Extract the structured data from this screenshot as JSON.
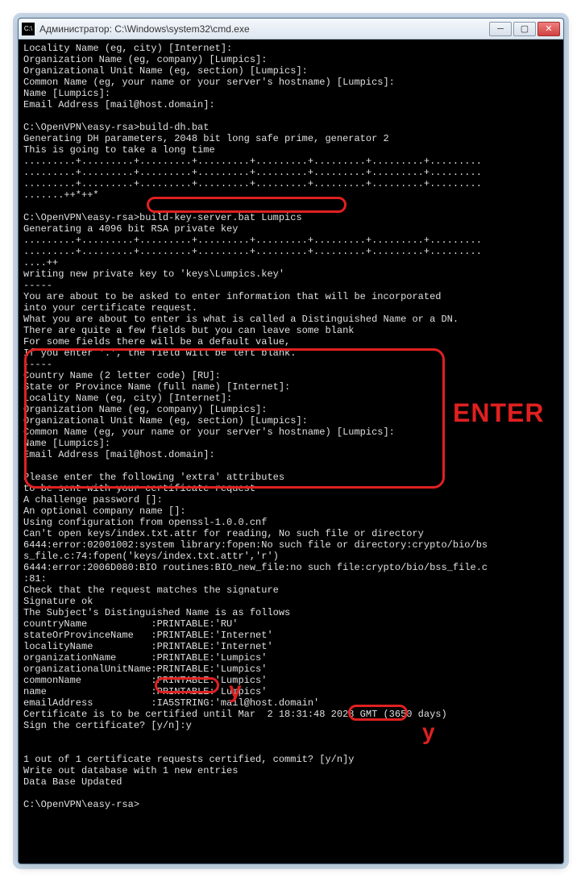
{
  "window": {
    "title": "Администратор: C:\\Windows\\system32\\cmd.exe"
  },
  "terminal": {
    "lines": [
      "Locality Name (eg, city) [Internet]:",
      "Organization Name (eg, company) [Lumpics]:",
      "Organizational Unit Name (eg, section) [Lumpics]:",
      "Common Name (eg, your name or your server's hostname) [Lumpics]:",
      "Name [Lumpics]:",
      "Email Address [mail@host.domain]:",
      "",
      "C:\\OpenVPN\\easy-rsa>build-dh.bat",
      "Generating DH parameters, 2048 bit long safe prime, generator 2",
      "This is going to take a long time",
      ".........+.........+.........+.........+.........+.........+.........+.........",
      ".........+.........+.........+.........+.........+.........+.........+.........",
      ".........+.........+.........+.........+.........+.........+.........+.........",
      ".......++*++*",
      "",
      "C:\\OpenVPN\\easy-rsa>build-key-server.bat Lumpics",
      "Generating a 4096 bit RSA private key",
      ".........+.........+.........+.........+.........+.........+.........+.........",
      ".........+.........+.........+.........+.........+.........+.........+.........",
      "....++",
      "writing new private key to 'keys\\Lumpics.key'",
      "-----",
      "You are about to be asked to enter information that will be incorporated",
      "into your certificate request.",
      "What you are about to enter is what is called a Distinguished Name or a DN.",
      "There are quite a few fields but you can leave some blank",
      "For some fields there will be a default value,",
      "If you enter '.', the field will be left blank.",
      "-----",
      "Country Name (2 letter code) [RU]:",
      "State or Province Name (full name) [Internet]:",
      "Locality Name (eg, city) [Internet]:",
      "Organization Name (eg, company) [Lumpics]:",
      "Organizational Unit Name (eg, section) [Lumpics]:",
      "Common Name (eg, your name or your server's hostname) [Lumpics]:",
      "Name [Lumpics]:",
      "Email Address [mail@host.domain]:",
      "",
      "Please enter the following 'extra' attributes",
      "to be sent with your certificate request",
      "A challenge password []:",
      "An optional company name []:",
      "Using configuration from openssl-1.0.0.cnf",
      "Can't open keys/index.txt.attr for reading, No such file or directory",
      "6444:error:02001002:system library:fopen:No such file or directory:crypto/bio/bs",
      "s_file.c:74:fopen('keys/index.txt.attr','r')",
      "6444:error:2006D080:BIO routines:BIO_new_file:no such file:crypto/bio/bss_file.c",
      ":81:",
      "Check that the request matches the signature",
      "Signature ok",
      "The Subject's Distinguished Name is as follows",
      "countryName           :PRINTABLE:'RU'",
      "stateOrProvinceName   :PRINTABLE:'Internet'",
      "localityName          :PRINTABLE:'Internet'",
      "organizationName      :PRINTABLE:'Lumpics'",
      "organizationalUnitName:PRINTABLE:'Lumpics'",
      "commonName            :PRINTABLE:'Lumpics'",
      "name                  :PRINTABLE:'Lumpics'",
      "emailAddress          :IA5STRING:'mail@host.domain'",
      "Certificate is to be certified until Mar  2 18:31:48 2028 GMT (3650 days)",
      "Sign the certificate? [y/n]:y",
      "",
      "",
      "1 out of 1 certificate requests certified, commit? [y/n]y",
      "Write out database with 1 new entries",
      "Data Base Updated",
      "",
      "C:\\OpenVPN\\easy-rsa>"
    ]
  },
  "annotations": {
    "enter_label": "ENTER",
    "y1_label": "y",
    "y2_label": "y"
  }
}
